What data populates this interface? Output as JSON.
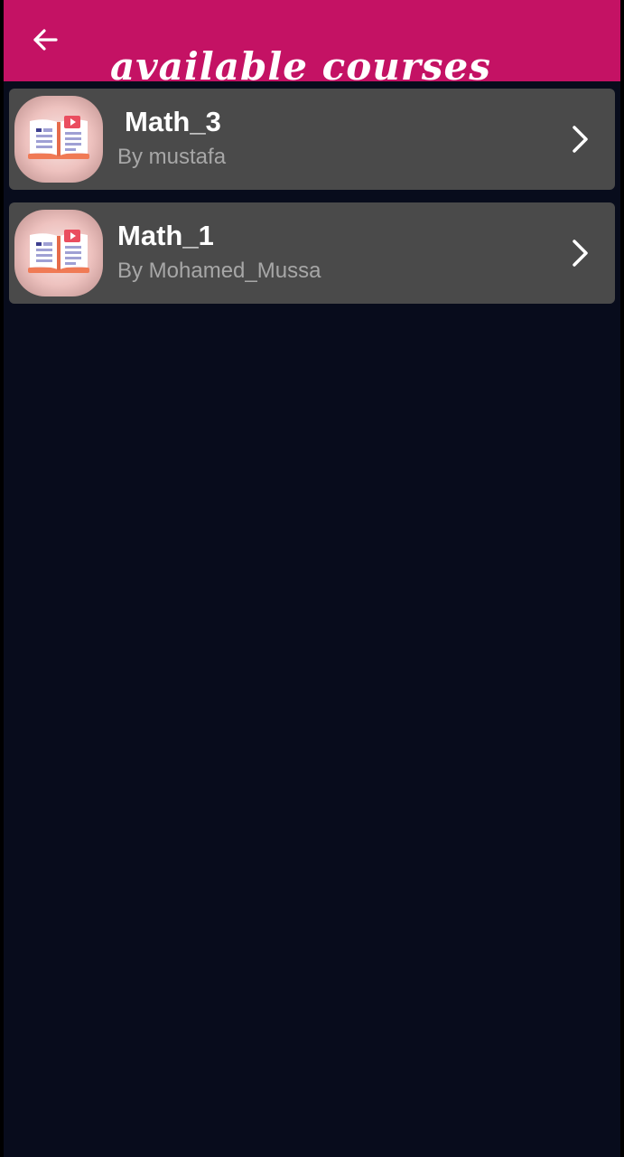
{
  "colors": {
    "app_bar": "#c41264",
    "background": "#080c1c",
    "card": "#4a4a4a",
    "title_text": "#ffffff",
    "author_text": "#a7a7a7"
  },
  "header": {
    "title": "available courses",
    "back_icon": "arrow-left-icon"
  },
  "courses": [
    {
      "title": "Math_3",
      "author": "By mustafa",
      "thumbnail_icon": "open-book-video-icon",
      "chevron_icon": "chevron-right-icon"
    },
    {
      "title": "Math_1",
      "author": "By Mohamed_Mussa",
      "thumbnail_icon": "open-book-video-icon",
      "chevron_icon": "chevron-right-icon"
    }
  ]
}
